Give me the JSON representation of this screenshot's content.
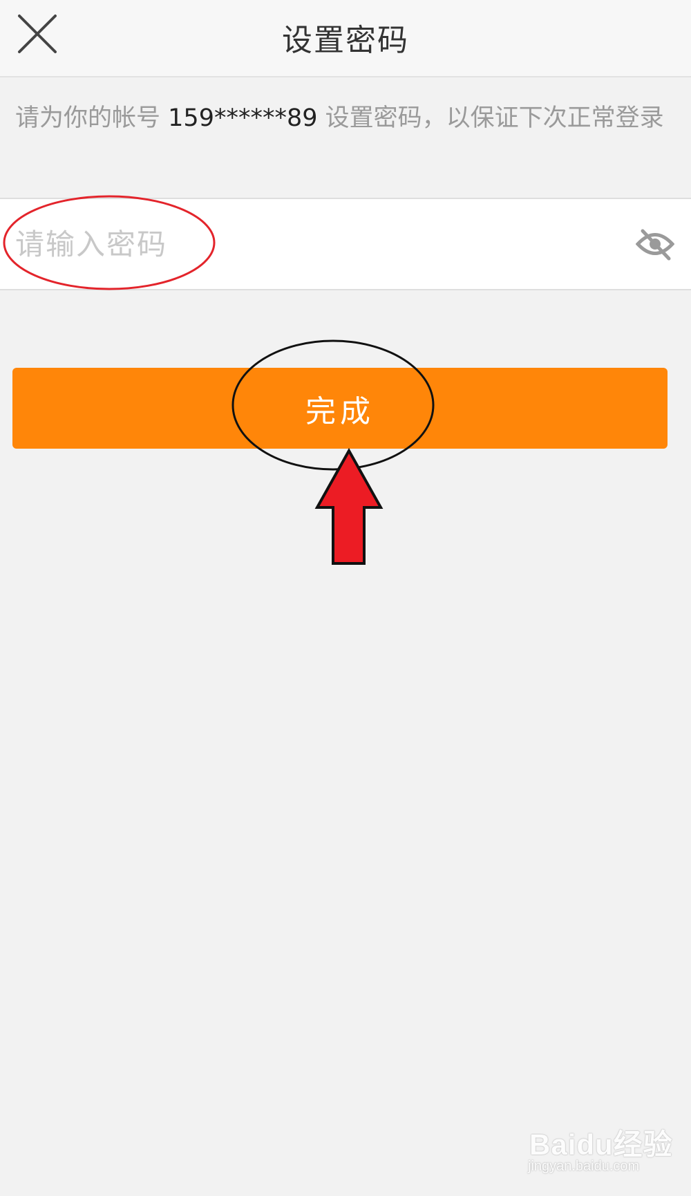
{
  "header": {
    "title": "设置密码"
  },
  "description": {
    "prefix": "请为你的帐号",
    "account": "159******89",
    "suffix": "设置密码，以保证下次正常登录"
  },
  "password_field": {
    "value": "",
    "placeholder": "请输入密码"
  },
  "done_button": {
    "label": "完成"
  },
  "colors": {
    "accent": "#ff8609",
    "background": "#f2f2f2"
  },
  "icons": {
    "close": "close-icon",
    "visibility": "eye-off-icon"
  },
  "watermark": {
    "text": "Baidu经验",
    "url": "jingyan.baidu.com"
  }
}
